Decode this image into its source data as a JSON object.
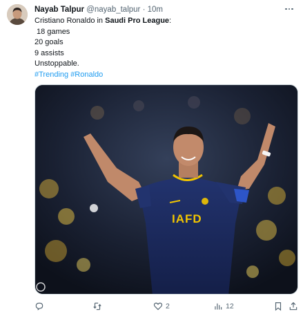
{
  "tweet": {
    "author_name": "Nayab Talpur",
    "handle": "@nayab_talpur",
    "separator": "·",
    "time": "10m",
    "text_prefix": "Cristiano Ronaldo in ",
    "text_bold": "Saudi Pro League",
    "text_suffix": ":",
    "stats": [
      "18 games",
      "20 goals",
      "9 assists"
    ],
    "closing": "Unstoppable.",
    "hashtags": [
      "#Trending",
      "#Ronaldo"
    ],
    "jersey_text": "IAFD"
  },
  "actions": {
    "replies": "",
    "retweets": "",
    "likes": "2",
    "views": "12"
  },
  "colors": {
    "link": "#1d9bf0",
    "muted": "#536471",
    "jersey": "#1a2a5e",
    "jersey_trim": "#f2c500"
  }
}
